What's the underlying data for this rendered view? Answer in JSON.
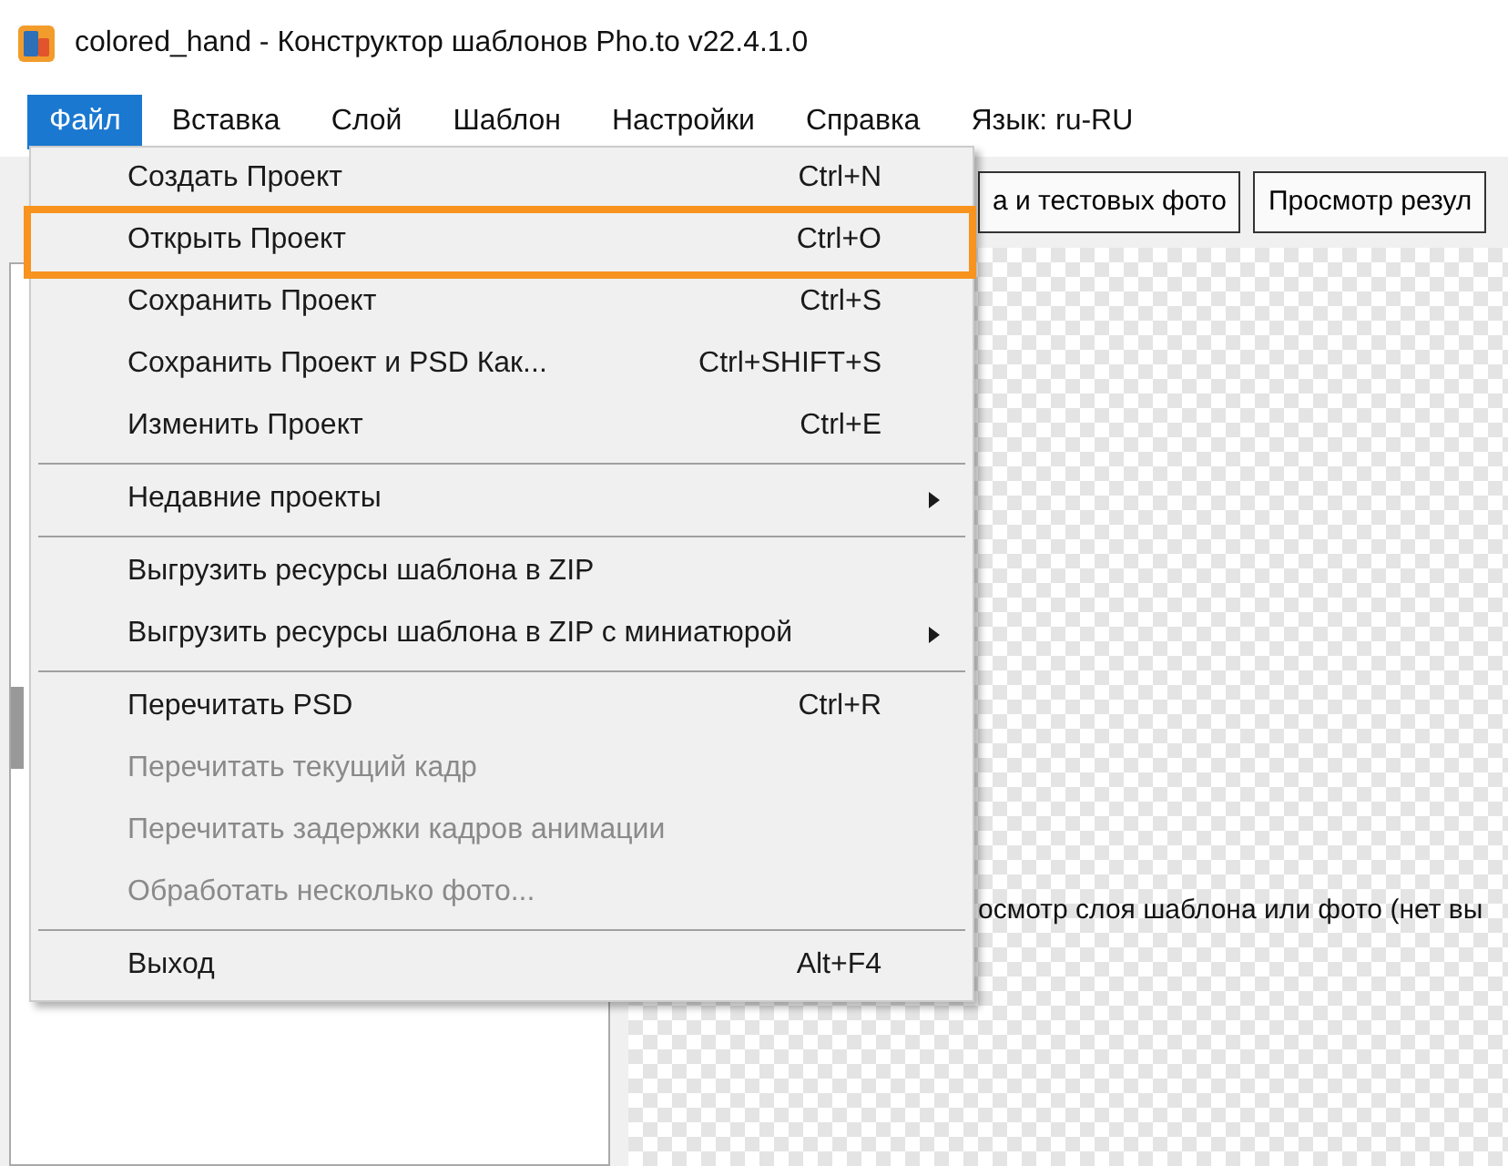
{
  "window": {
    "title": "colored_hand - Конструктор шаблонов Pho.to v22.4.1.0"
  },
  "menu_bar": [
    {
      "label": "Файл",
      "selected": true
    },
    {
      "label": "Вставка",
      "selected": false
    },
    {
      "label": "Слой",
      "selected": false
    },
    {
      "label": "Шаблон",
      "selected": false
    },
    {
      "label": "Настройки",
      "selected": false
    },
    {
      "label": "Справка",
      "selected": false
    },
    {
      "label": "Язык: ru-RU",
      "selected": false
    }
  ],
  "toolbar": [
    "а и тестовых фото",
    "Просмотр резул"
  ],
  "canvas": {
    "message": "осмотр слоя шаблона или фото (нет вы"
  },
  "file_menu": [
    {
      "kind": "item",
      "label": "Создать Проект",
      "shortcut": "Ctrl+N",
      "disabled": false,
      "annotated": false,
      "submenu": false
    },
    {
      "kind": "item",
      "label": "Открыть Проект",
      "shortcut": "Ctrl+O",
      "disabled": false,
      "annotated": true,
      "submenu": false
    },
    {
      "kind": "item",
      "label": "Сохранить Проект",
      "shortcut": "Ctrl+S",
      "disabled": false,
      "annotated": false,
      "submenu": false
    },
    {
      "kind": "item",
      "label": "Сохранить Проект и PSD Как...",
      "shortcut": "Ctrl+SHIFT+S",
      "disabled": false,
      "annotated": false,
      "submenu": false
    },
    {
      "kind": "item",
      "label": "Изменить Проект",
      "shortcut": "Ctrl+E",
      "disabled": false,
      "annotated": false,
      "submenu": false
    },
    {
      "kind": "separator"
    },
    {
      "kind": "item",
      "label": "Недавние проекты",
      "disabled": false,
      "annotated": false,
      "submenu": true
    },
    {
      "kind": "separator"
    },
    {
      "kind": "item",
      "label": "Выгрузить ресурсы шаблона в ZIP",
      "disabled": false,
      "annotated": false,
      "submenu": false
    },
    {
      "kind": "item",
      "label": "Выгрузить ресурсы шаблона в ZIP с миниатюрой",
      "disabled": false,
      "annotated": false,
      "submenu": true
    },
    {
      "kind": "separator"
    },
    {
      "kind": "item",
      "label": "Перечитать PSD",
      "shortcut": "Ctrl+R",
      "disabled": false,
      "annotated": false,
      "submenu": false
    },
    {
      "kind": "item",
      "label": "Перечитать текущий кадр",
      "disabled": true,
      "annotated": false,
      "submenu": false
    },
    {
      "kind": "item",
      "label": "Перечитать задержки кадров анимации",
      "disabled": true,
      "annotated": false,
      "submenu": false
    },
    {
      "kind": "item",
      "label": "Обработать несколько фото...",
      "disabled": true,
      "annotated": false,
      "submenu": false
    },
    {
      "kind": "separator"
    },
    {
      "kind": "item",
      "label": "Выход",
      "shortcut": "Alt+F4",
      "disabled": false,
      "annotated": false,
      "submenu": false
    }
  ]
}
